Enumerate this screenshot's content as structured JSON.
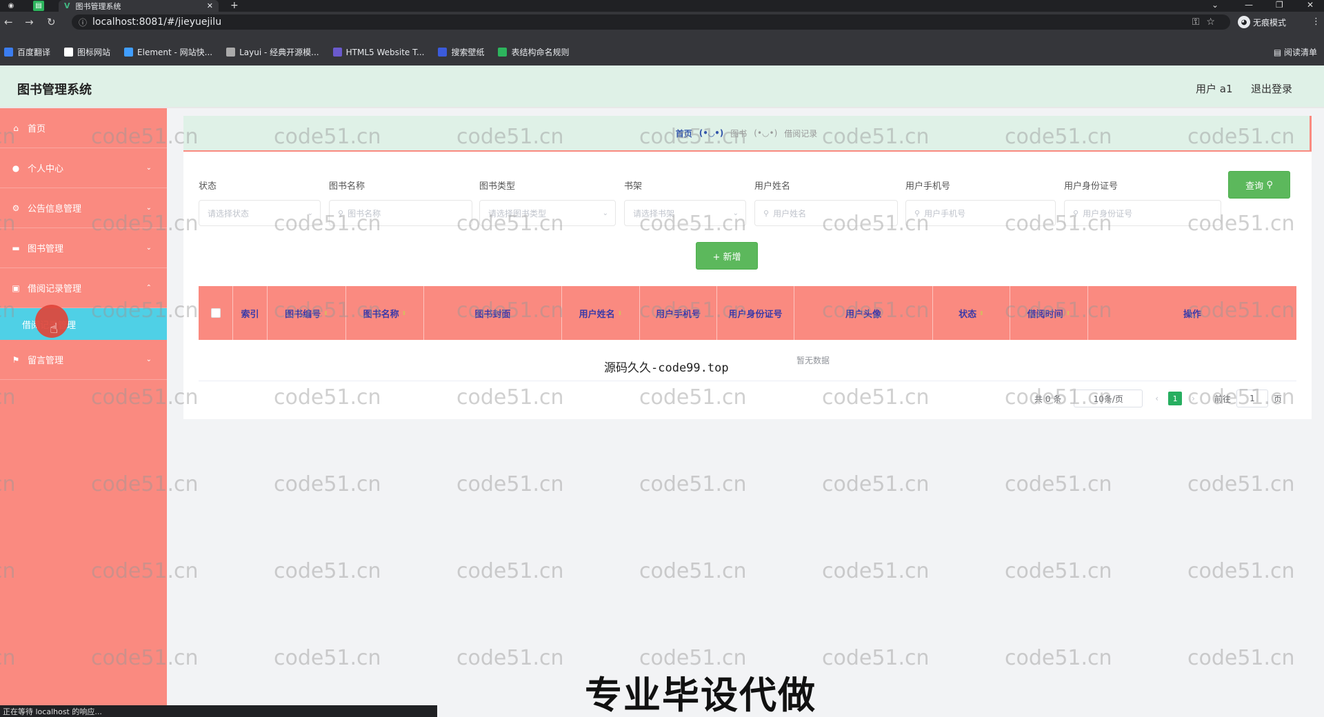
{
  "browser": {
    "tab_title": "图书管理系统",
    "url": "localhost:8081/#/jieyuejilu",
    "incognito_label": "无痕模式",
    "reading_list": "阅读清单",
    "bookmarks": [
      {
        "label": "百度翻译",
        "color": "#3b7df0"
      },
      {
        "label": "图标网站",
        "color": "#ffffff"
      },
      {
        "label": "Element - 网站快...",
        "color": "#409eff"
      },
      {
        "label": "Layui - 经典开源模...",
        "color": "#aaaaaa"
      },
      {
        "label": "HTML5 Website T...",
        "color": "#6a5acd"
      },
      {
        "label": "搜索壁纸",
        "color": "#3b5bdb"
      },
      {
        "label": "表结构命名规则",
        "color": "#2db55d"
      }
    ],
    "status_text": "正在等待 localhost 的响应..."
  },
  "app": {
    "title": "图书管理系统",
    "user": "用户 a1",
    "logout": "退出登录"
  },
  "sidebar": {
    "items": [
      {
        "label": "首页",
        "icon": "home-icon"
      },
      {
        "label": "个人中心",
        "icon": "user-icon"
      },
      {
        "label": "公告信息管理",
        "icon": "gear-icon"
      },
      {
        "label": "图书管理",
        "icon": "monitor-icon"
      },
      {
        "label": "借阅记录管理",
        "icon": "clipboard-icon"
      },
      {
        "label": "借阅记录管理",
        "icon": ""
      },
      {
        "label": "留言管理",
        "icon": "flag-icon"
      }
    ]
  },
  "breadcrumb": {
    "home": "首页",
    "sep": "(•◡•)",
    "mid": "图书",
    "current": "借阅记录"
  },
  "filters": {
    "labels": [
      "状态",
      "图书名称",
      "图书类型",
      "书架",
      "用户姓名",
      "用户手机号",
      "用户身份证号"
    ],
    "placeholders": [
      "请选择状态",
      "图书名称",
      "请选择图书类型",
      "请选择书架",
      "用户姓名",
      "用户手机号",
      "用户身份证号"
    ],
    "query_button": "查询",
    "add_button": "+ 新增"
  },
  "table": {
    "columns": [
      "索引",
      "图书编号",
      "图书名称",
      "图书封面",
      "用户姓名",
      "用户手机号",
      "用户身份证号",
      "用户头像",
      "状态",
      "借阅时间",
      "操作"
    ],
    "empty_text": "暂无数据"
  },
  "pagination": {
    "total": "共 0 条",
    "page_size": "10条/页",
    "current_page": "1",
    "goto_label": "前往",
    "goto_value": "1",
    "page_suffix": "页"
  },
  "overlays": {
    "watermark_text": "code51.cn",
    "mono_text": "源码久久-code99.top",
    "big_text": "专业毕设代做"
  },
  "colors": {
    "sidebar_bg": "#fa8a80",
    "header_bg": "#dff1e7",
    "active_sub": "#4fd0e6",
    "button_green": "#5cb85c",
    "table_head": "#fa8a80"
  }
}
